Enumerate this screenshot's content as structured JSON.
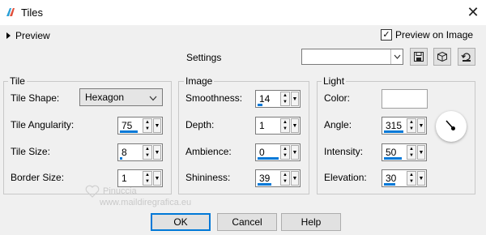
{
  "window": {
    "title": "Tiles"
  },
  "preview": {
    "label": "Preview",
    "preview_on_image_label": "Preview on Image",
    "preview_on_image_checked": true
  },
  "settings": {
    "label": "Settings",
    "preset_value": ""
  },
  "tile": {
    "title": "Tile",
    "shape_label": "Tile Shape:",
    "shape_value": "Hexagon",
    "angularity_label": "Tile Angularity:",
    "angularity_value": "75",
    "size_label": "Tile Size:",
    "size_value": "8",
    "border_label": "Border Size:",
    "border_value": "1"
  },
  "image": {
    "title": "Image",
    "smoothness_label": "Smoothness:",
    "smoothness_value": "14",
    "depth_label": "Depth:",
    "depth_value": "1",
    "ambience_label": "Ambience:",
    "ambience_value": "0",
    "shininess_label": "Shininess:",
    "shininess_value": "39"
  },
  "light": {
    "title": "Light",
    "color_label": "Color:",
    "color_value": "#ffffff",
    "angle_label": "Angle:",
    "angle_value": "315",
    "intensity_label": "Intensity:",
    "intensity_value": "50",
    "elevation_label": "Elevation:",
    "elevation_value": "30"
  },
  "buttons": {
    "ok": "OK",
    "cancel": "Cancel",
    "help": "Help"
  },
  "watermark": {
    "line1": "Pinuccia",
    "line2": "www.maildiregrafica.eu"
  },
  "icons": {
    "app": "tiles-app-icon",
    "close": "close-icon",
    "expand": "expand-triangle-icon",
    "save": "save-icon",
    "delete": "delete-preset-icon",
    "reset": "reset-icon",
    "dial": "angle-dial-icon"
  },
  "colors": {
    "accent": "#0078d7",
    "background": "#f0f0f0"
  }
}
